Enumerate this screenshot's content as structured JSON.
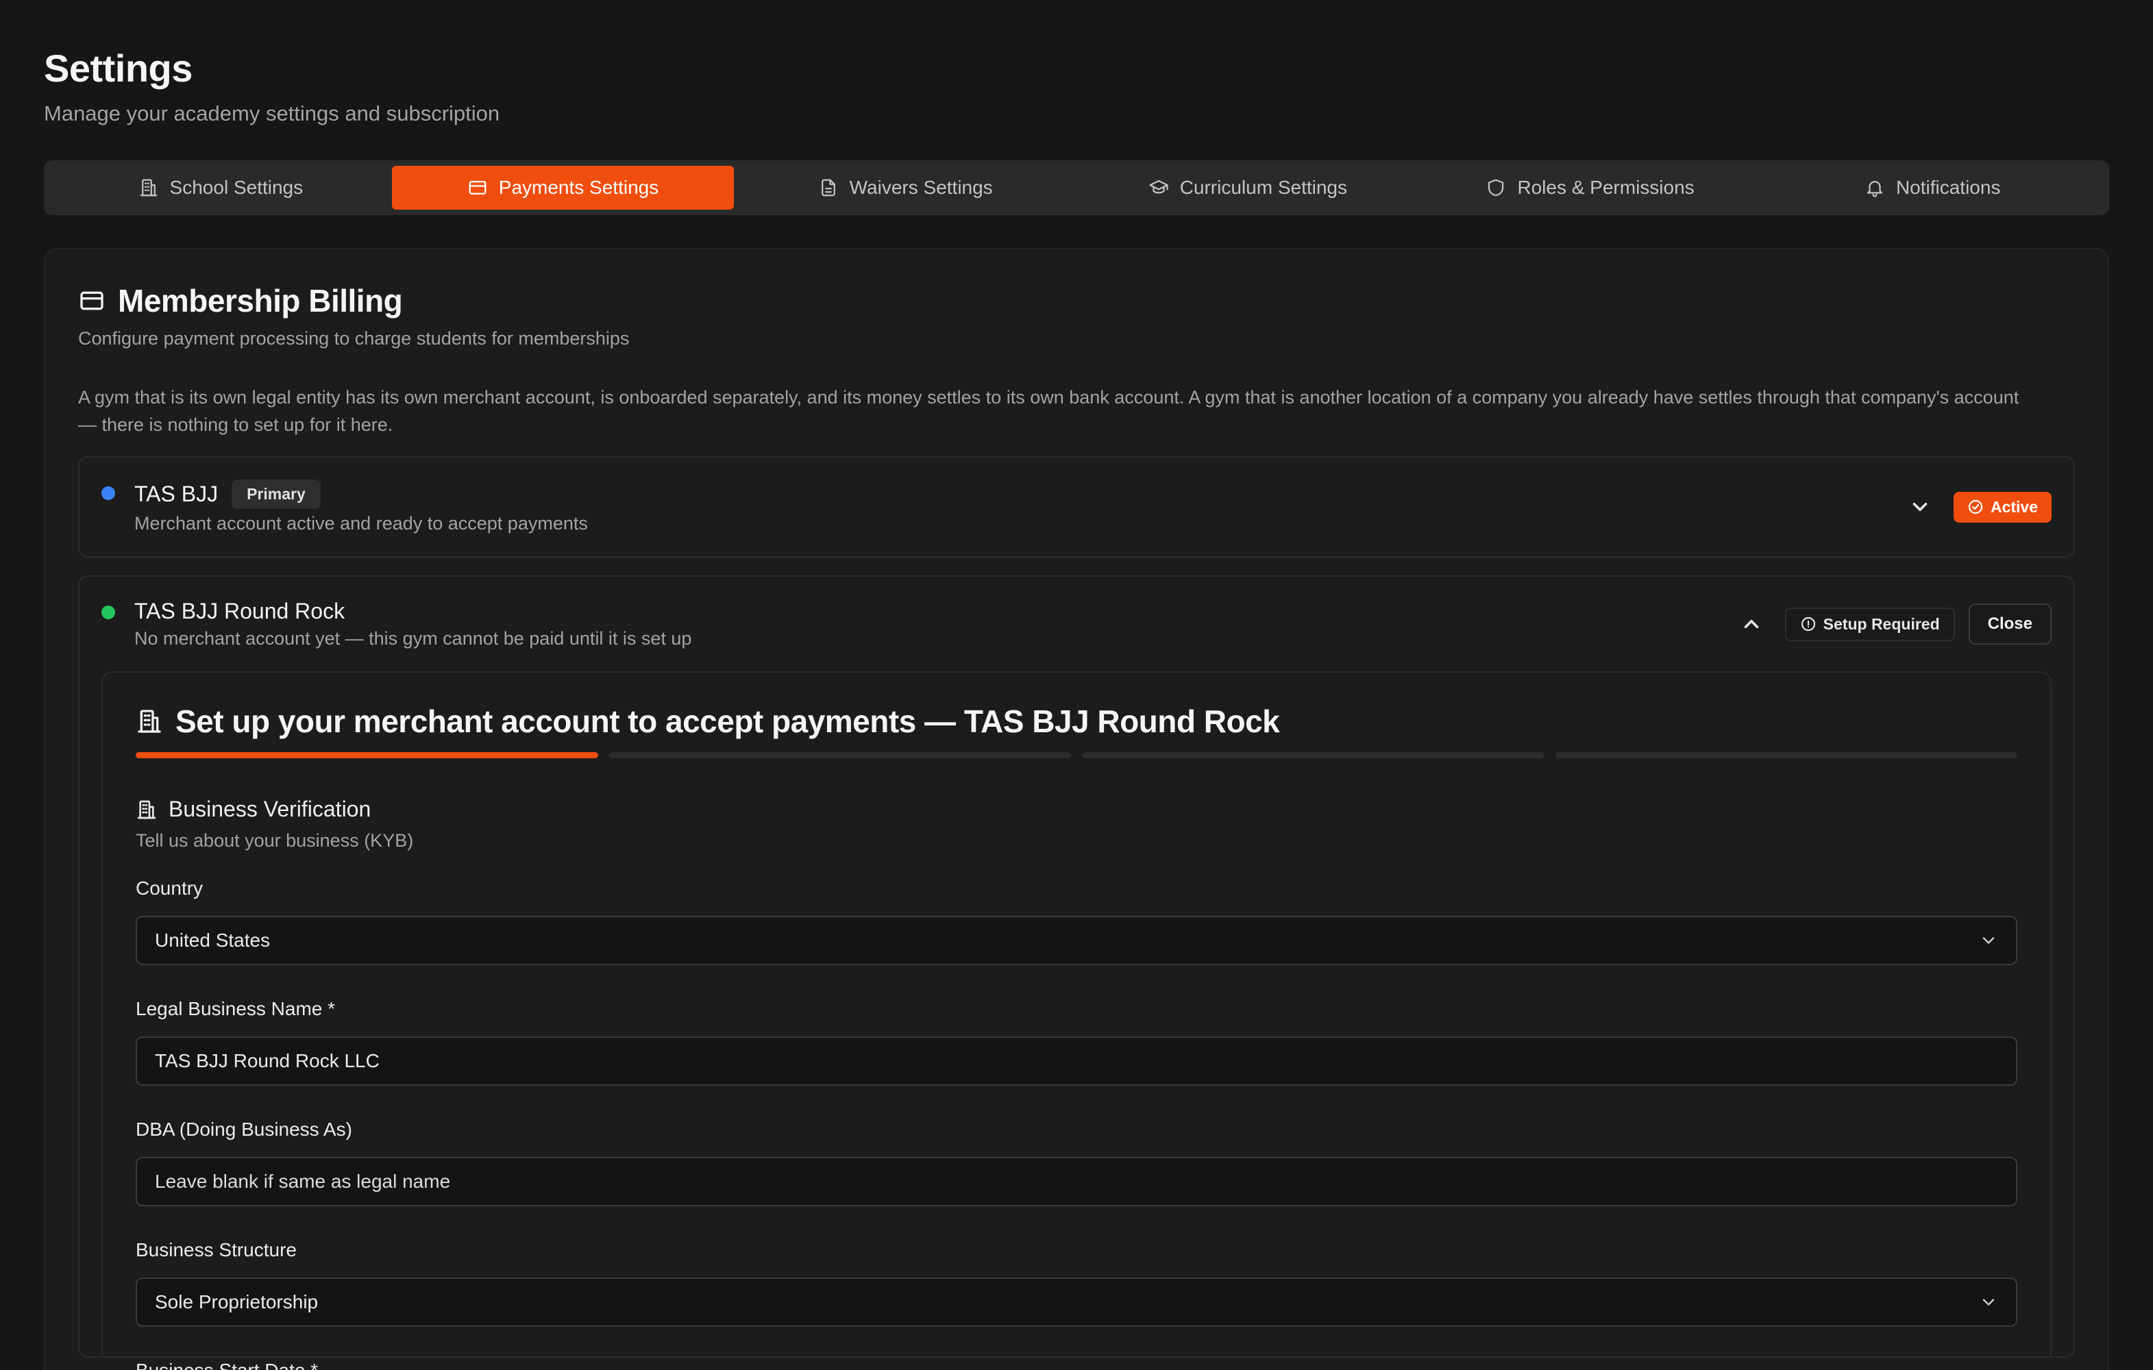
{
  "page": {
    "title": "Settings",
    "subtitle": "Manage your academy settings and subscription"
  },
  "tabs": [
    {
      "label": "School Settings",
      "icon": "building-icon"
    },
    {
      "label": "Payments Settings",
      "icon": "credit-card-icon",
      "active": true
    },
    {
      "label": "Waivers Settings",
      "icon": "document-icon"
    },
    {
      "label": "Curriculum Settings",
      "icon": "graduation-cap-icon"
    },
    {
      "label": "Roles & Permissions",
      "icon": "shield-icon"
    },
    {
      "label": "Notifications",
      "icon": "bell-icon"
    }
  ],
  "billing": {
    "title": "Membership Billing",
    "subtitle": "Configure payment processing to charge students for memberships",
    "description": "A gym that is its own legal entity has its own merchant account, is onboarded separately, and its money settles to its own bank account. A gym that is another location of a company you already have settles through that company's account — there is nothing to set up for it here."
  },
  "gyms": [
    {
      "name": "TAS BJJ",
      "badge": "Primary",
      "status": "Merchant account active and ready to accept payments",
      "state_label": "Active",
      "dot_color": "#3b82f6"
    },
    {
      "name": "TAS BJJ Round Rock",
      "status": "No merchant account yet — this gym cannot be paid until it is set up",
      "state_label": "Setup Required",
      "close_label": "Close",
      "dot_color": "#22c55e"
    }
  ],
  "setup": {
    "title": "Set up your merchant account to accept payments — TAS BJJ Round Rock",
    "progress": {
      "current_step": 1,
      "total_steps": 4
    },
    "step_title": "Business Verification",
    "step_subtitle": "Tell us about your business (KYB)",
    "fields": {
      "country": {
        "label": "Country",
        "value": "United States"
      },
      "legal_name": {
        "label": "Legal Business Name *",
        "value": "TAS BJJ Round Rock LLC"
      },
      "dba": {
        "label": "DBA (Doing Business As)",
        "placeholder": "Leave blank if same as legal name"
      },
      "structure": {
        "label": "Business Structure",
        "value": "Sole Proprietorship"
      },
      "start_date": {
        "label": "Business Start Date *"
      }
    }
  },
  "colors": {
    "accent": "#f04e0f",
    "background": "#161616",
    "card": "#1c1c1c"
  }
}
